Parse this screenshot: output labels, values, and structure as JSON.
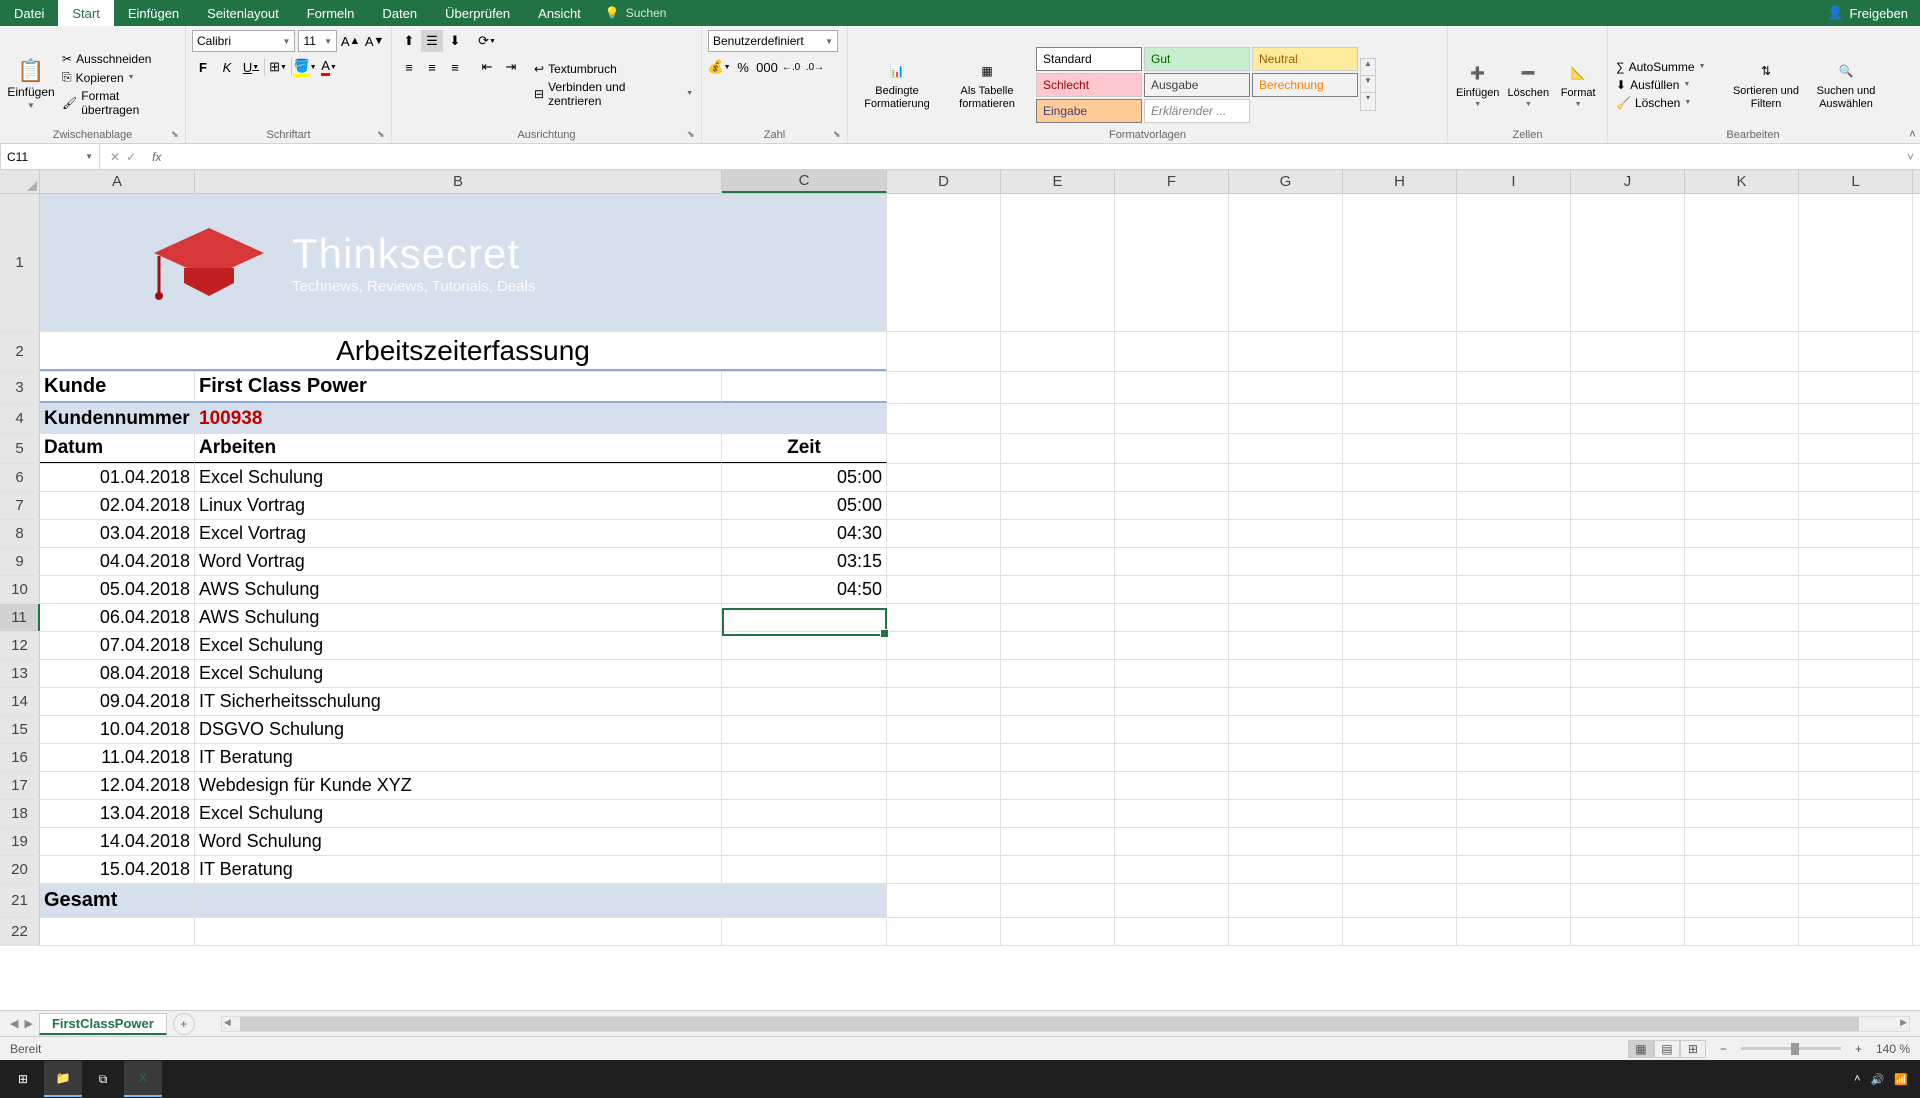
{
  "titlebar": {
    "file": "Datei",
    "tabs": [
      "Start",
      "Einfügen",
      "Seitenlayout",
      "Formeln",
      "Daten",
      "Überprüfen",
      "Ansicht"
    ],
    "active_tab": "Start",
    "search": "Suchen",
    "share": "Freigeben"
  },
  "ribbon": {
    "clipboard": {
      "label": "Zwischenablage",
      "paste": "Einfügen",
      "cut": "Ausschneiden",
      "copy": "Kopieren",
      "format_painter": "Format übertragen"
    },
    "font": {
      "label": "Schriftart",
      "name": "Calibri",
      "size": "11"
    },
    "alignment": {
      "label": "Ausrichtung",
      "wrap": "Textumbruch",
      "merge": "Verbinden und zentrieren"
    },
    "number": {
      "label": "Zahl",
      "format": "Benutzerdefiniert"
    },
    "styles": {
      "label": "Formatvorlagen",
      "cond": "Bedingte Formatierung",
      "table": "Als Tabelle formatieren",
      "items": [
        "Standard",
        "Gut",
        "Neutral",
        "Schlecht",
        "Ausgabe",
        "Berechnung",
        "Eingabe",
        "Erklärender ..."
      ]
    },
    "cells": {
      "label": "Zellen",
      "insert": "Einfügen",
      "delete": "Löschen",
      "format": "Format"
    },
    "editing": {
      "label": "Bearbeiten",
      "autosum": "AutoSumme",
      "fill": "Ausfüllen",
      "clear": "Löschen",
      "sort": "Sortieren und Filtern",
      "find": "Suchen und Auswählen"
    }
  },
  "namebox": "C11",
  "columns": [
    "A",
    "B",
    "C",
    "D",
    "E",
    "F",
    "G",
    "H",
    "I",
    "J",
    "K",
    "L"
  ],
  "sheet": {
    "title": "Arbeitszeiterfassung",
    "kunde_label": "Kunde",
    "kunde_value": "First Class Power",
    "kundennr_label": "Kundennummer",
    "kundennr_value": "100938",
    "headers": {
      "datum": "Datum",
      "arbeiten": "Arbeiten",
      "zeit": "Zeit"
    },
    "rows": [
      {
        "d": "01.04.2018",
        "a": "Excel Schulung",
        "z": "05:00"
      },
      {
        "d": "02.04.2018",
        "a": "Linux Vortrag",
        "z": "05:00"
      },
      {
        "d": "03.04.2018",
        "a": "Excel Vortrag",
        "z": "04:30"
      },
      {
        "d": "04.04.2018",
        "a": "Word Vortrag",
        "z": "03:15"
      },
      {
        "d": "05.04.2018",
        "a": "AWS Schulung",
        "z": "04:50"
      },
      {
        "d": "06.04.2018",
        "a": "AWS Schulung",
        "z": ""
      },
      {
        "d": "07.04.2018",
        "a": "Excel Schulung",
        "z": ""
      },
      {
        "d": "08.04.2018",
        "a": "Excel Schulung",
        "z": ""
      },
      {
        "d": "09.04.2018",
        "a": "IT Sicherheitsschulung",
        "z": ""
      },
      {
        "d": "10.04.2018",
        "a": "DSGVO Schulung",
        "z": ""
      },
      {
        "d": "11.04.2018",
        "a": "IT Beratung",
        "z": ""
      },
      {
        "d": "12.04.2018",
        "a": "Webdesign für Kunde XYZ",
        "z": ""
      },
      {
        "d": "13.04.2018",
        "a": "Excel Schulung",
        "z": ""
      },
      {
        "d": "14.04.2018",
        "a": "Word Schulung",
        "z": ""
      },
      {
        "d": "15.04.2018",
        "a": "IT Beratung",
        "z": ""
      }
    ],
    "gesamt": "Gesamt",
    "logo_text": "Thinksecret",
    "logo_sub": "Technews, Reviews, Tutorials, Deals"
  },
  "sheet_tab": "FirstClassPower",
  "status": "Bereit",
  "zoom": "140 %",
  "style_colors": {
    "Standard": {
      "bg": "#ffffff",
      "fg": "#000000",
      "border": "#7f7f7f"
    },
    "Gut": {
      "bg": "#c6efce",
      "fg": "#006100"
    },
    "Neutral": {
      "bg": "#ffeb9c",
      "fg": "#9c5700"
    },
    "Schlecht": {
      "bg": "#ffc7ce",
      "fg": "#9c0006"
    },
    "Ausgabe": {
      "bg": "#f2f2f2",
      "fg": "#3f3f3f",
      "border": "#7f7f7f"
    },
    "Berechnung": {
      "bg": "#f2f2f2",
      "fg": "#fa7d00",
      "border": "#7f7f7f"
    },
    "Eingabe": {
      "bg": "#ffcc99",
      "fg": "#3f3f76",
      "border": "#7f7f7f"
    },
    "Erklärender ...": {
      "bg": "#ffffff",
      "fg": "#7f7f7f",
      "italic": true
    }
  }
}
